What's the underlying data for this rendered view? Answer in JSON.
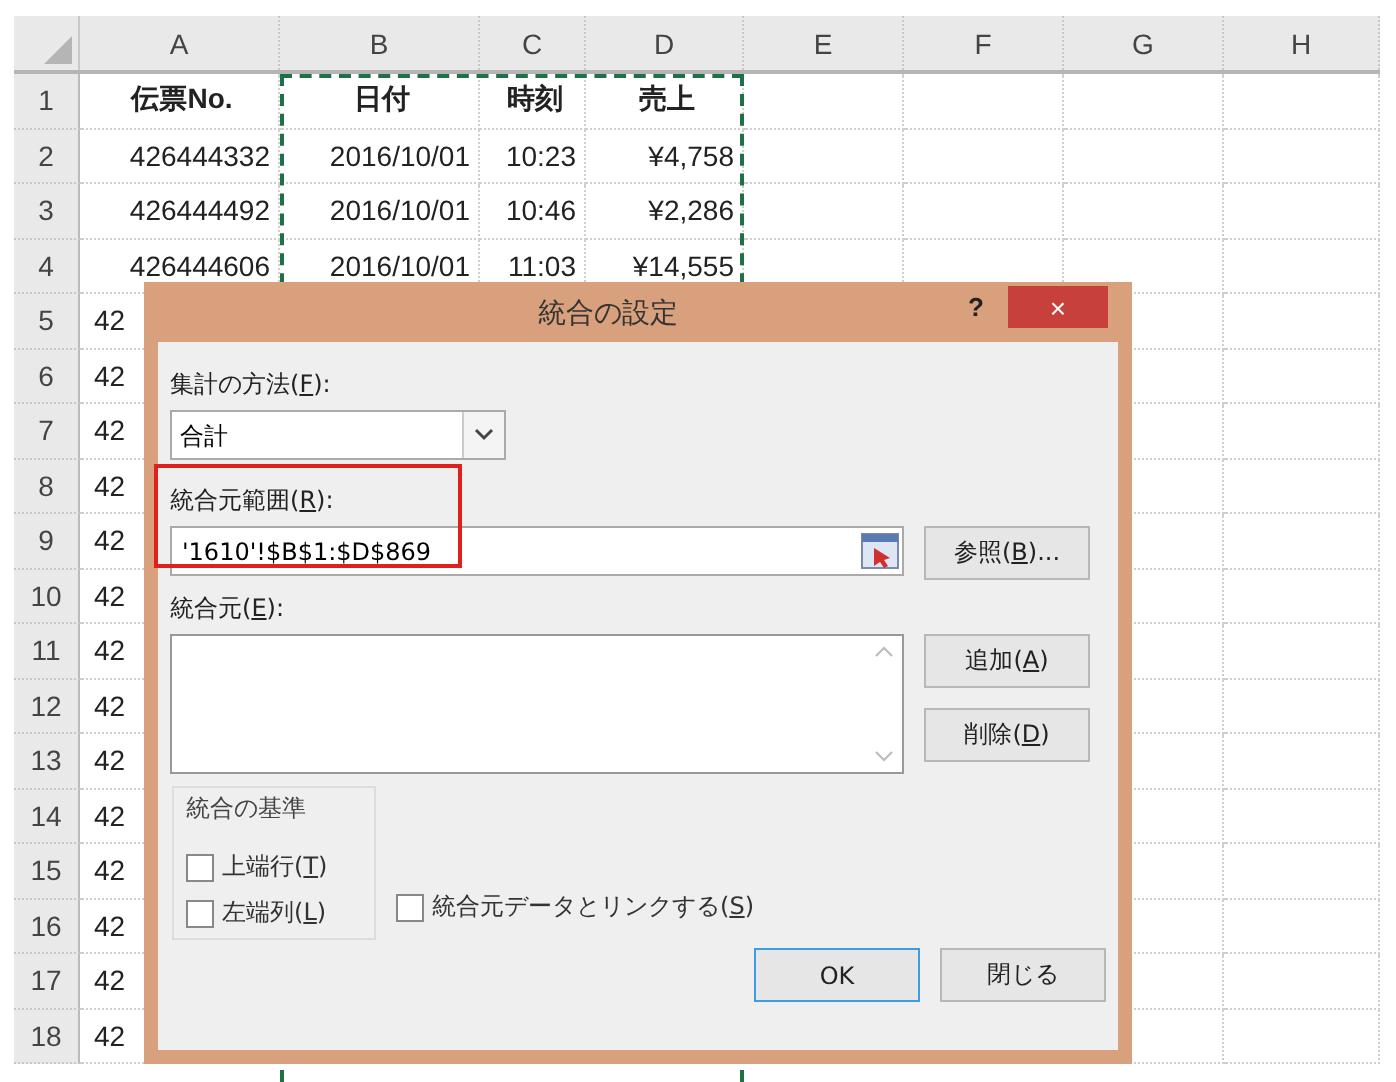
{
  "columns": [
    "A",
    "B",
    "C",
    "D",
    "E",
    "F",
    "G",
    "H"
  ],
  "rows": [
    {
      "number": "1",
      "cells": [
        "伝票No.",
        "日付",
        "時刻",
        "売上"
      ],
      "kind": "header"
    },
    {
      "number": "2",
      "cells": [
        "426444332",
        "2016/10/01",
        "10:23",
        "¥4,758"
      ],
      "kind": "data"
    },
    {
      "number": "3",
      "cells": [
        "426444492",
        "2016/10/01",
        "10:46",
        "¥2,286"
      ],
      "kind": "data"
    },
    {
      "number": "4",
      "cells": [
        "426444606",
        "2016/10/01",
        "11:03",
        "¥14,555"
      ],
      "kind": "data"
    },
    {
      "number": "5",
      "cells": [
        "42"
      ],
      "kind": "covered"
    },
    {
      "number": "6",
      "cells": [
        "42"
      ],
      "kind": "covered"
    },
    {
      "number": "7",
      "cells": [
        "42"
      ],
      "kind": "covered"
    },
    {
      "number": "8",
      "cells": [
        "42"
      ],
      "kind": "covered"
    },
    {
      "number": "9",
      "cells": [
        "42"
      ],
      "kind": "covered"
    },
    {
      "number": "10",
      "cells": [
        "42"
      ],
      "kind": "covered"
    },
    {
      "number": "11",
      "cells": [
        "42"
      ],
      "kind": "covered"
    },
    {
      "number": "12",
      "cells": [
        "42"
      ],
      "kind": "covered"
    },
    {
      "number": "13",
      "cells": [
        "42"
      ],
      "kind": "covered"
    },
    {
      "number": "14",
      "cells": [
        "42"
      ],
      "kind": "covered"
    },
    {
      "number": "15",
      "cells": [
        "42"
      ],
      "kind": "covered"
    },
    {
      "number": "16",
      "cells": [
        "42"
      ],
      "kind": "covered"
    },
    {
      "number": "17",
      "cells": [
        "42"
      ],
      "kind": "covered"
    },
    {
      "number": "18",
      "cells": [
        "42"
      ],
      "kind": "covered"
    }
  ],
  "dialog": {
    "title": "統合の設定",
    "help": "?",
    "close": "×",
    "function_label": {
      "pre": "集計の方法(",
      "key": "F",
      "post": "):"
    },
    "function_value": "合計",
    "reference_label": {
      "pre": "統合元範囲(",
      "key": "R",
      "post": "):"
    },
    "reference_value": "'1610'!$B$1:$D$869",
    "browse_button": {
      "pre": "参照(",
      "key": "B",
      "post": ")...",
      "default": false
    },
    "sources_label": {
      "pre": "統合元(",
      "key": "E",
      "post": "):"
    },
    "add_button": {
      "pre": "追加(",
      "key": "A",
      "post": ")",
      "default": false
    },
    "delete_button": {
      "pre": "削除(",
      "key": "D",
      "post": ")",
      "default": false
    },
    "labels_group": "統合の基準",
    "checkboxes": [
      {
        "pre": "上端行(",
        "key": "T",
        "post": ")",
        "checked": false
      },
      {
        "pre": "左端列(",
        "key": "L",
        "post": ")",
        "checked": false
      }
    ],
    "link_checkbox": {
      "pre": "統合元データとリンクする(",
      "key": "S",
      "post": ")",
      "checked": false
    },
    "ok_button": {
      "pre": "OK",
      "default": true
    },
    "close_button": {
      "pre": "閉じる",
      "default": false
    }
  }
}
